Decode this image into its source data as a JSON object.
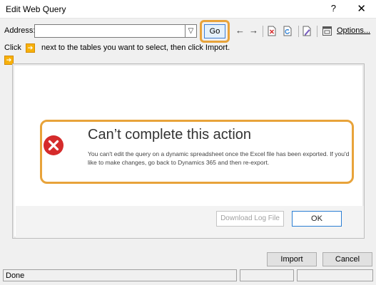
{
  "window": {
    "title": "Edit Web Query",
    "help_glyph": "?",
    "close_glyph": "✕"
  },
  "toolbar": {
    "address_label": "Address:",
    "address_value": "",
    "dropdown_glyph": "▽",
    "go_label": "Go",
    "back_glyph": "←",
    "forward_glyph": "→",
    "options_label": "Options..."
  },
  "hint": {
    "click": "Click",
    "arrow_glyph": "➔",
    "rest": "next to the tables you want to select, then click Import."
  },
  "error_dialog": {
    "title": "Can’t complete this action",
    "message": "You can't edit the query on a dynamic spreadsheet once the Excel file has been exported. If you'd like to make changes, go back to Dynamics 365 and then re-export.",
    "download_label": "Download Log File",
    "ok_label": "OK"
  },
  "footer": {
    "import_label": "Import",
    "cancel_label": "Cancel"
  },
  "status": {
    "text": "Done"
  },
  "colors": {
    "highlight": "#e8a33a",
    "error_red": "#d52b2b",
    "accent_blue": "#2b7fd4"
  }
}
